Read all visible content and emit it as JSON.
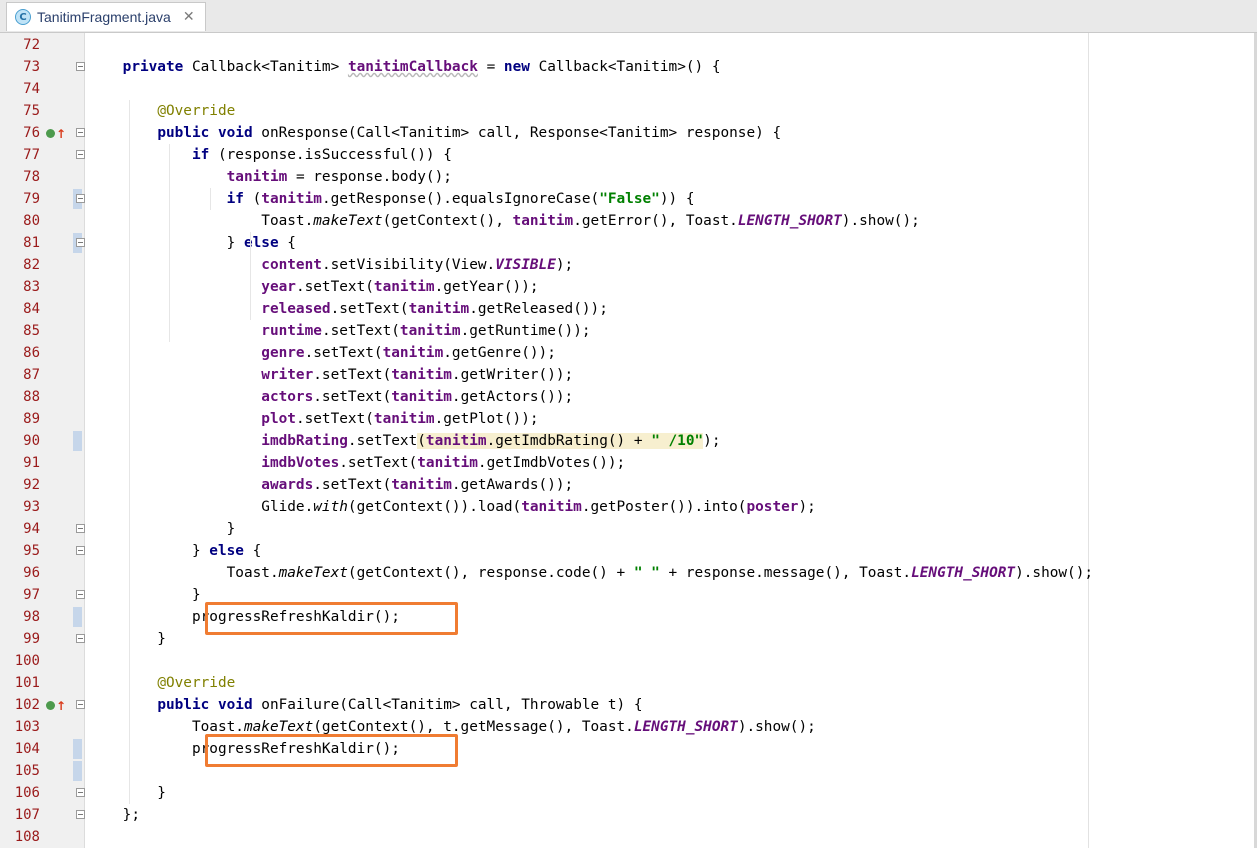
{
  "tab": {
    "icon_letter": "C",
    "file_name": "TanitimFragment.java",
    "close_glyph": "✕"
  },
  "colors": {
    "highlight_box": "#f07c32",
    "keyword": "#000080",
    "field": "#660e7a",
    "string": "#008000",
    "annotation": "#808000",
    "line_number": "#9a1a1a"
  },
  "lines": [
    {
      "num": "72",
      "html": ""
    },
    {
      "num": "73",
      "html": "    <span class=\"kw\">private</span> Callback&lt;Tanitim&gt; <span class=\"fld under\">tanitimCallback</span> = <span class=\"kw\">new</span> Callback&lt;Tanitim&gt;() {"
    },
    {
      "num": "74",
      "html": ""
    },
    {
      "num": "75",
      "html": "        <span class=\"ann\">@Override</span>"
    },
    {
      "num": "76",
      "html": "        <span class=\"kw\">public void</span> onResponse(Call&lt;Tanitim&gt; call, Response&lt;Tanitim&gt; response) {"
    },
    {
      "num": "77",
      "html": "            <span class=\"kw\">if</span> (response.isSuccessful()) {"
    },
    {
      "num": "78",
      "html": "                <span class=\"fld\">tanitim</span> = response.body();"
    },
    {
      "num": "79",
      "html": "                <span class=\"kw\">if</span> (<span class=\"fld\">tanitim</span>.getResponse().equalsIgnoreCase(<span class=\"str\">\"False\"</span>)) {"
    },
    {
      "num": "80",
      "html": "                    Toast.<span class=\"it\">makeText</span>(getContext(), <span class=\"fld\">tanitim</span>.getError(), Toast.<span class=\"st\">LENGTH_SHORT</span>).show();"
    },
    {
      "num": "81",
      "html": "                } <span class=\"kw\">else</span> {"
    },
    {
      "num": "82",
      "html": "                    <span class=\"fld\">content</span>.setVisibility(View.<span class=\"st\">VISIBLE</span>);"
    },
    {
      "num": "83",
      "html": "                    <span class=\"fld\">year</span>.setText(<span class=\"fld\">tanitim</span>.getYear());"
    },
    {
      "num": "84",
      "html": "                    <span class=\"fld\">released</span>.setText(<span class=\"fld\">tanitim</span>.getReleased());"
    },
    {
      "num": "85",
      "html": "                    <span class=\"fld\">runtime</span>.setText(<span class=\"fld\">tanitim</span>.getRuntime());"
    },
    {
      "num": "86",
      "html": "                    <span class=\"fld\">genre</span>.setText(<span class=\"fld\">tanitim</span>.getGenre());"
    },
    {
      "num": "87",
      "html": "                    <span class=\"fld\">writer</span>.setText(<span class=\"fld\">tanitim</span>.getWriter());"
    },
    {
      "num": "88",
      "html": "                    <span class=\"fld\">actors</span>.setText(<span class=\"fld\">tanitim</span>.getActors());"
    },
    {
      "num": "89",
      "html": "                    <span class=\"fld\">plot</span>.setText(<span class=\"fld\">tanitim</span>.getPlot());"
    },
    {
      "num": "90",
      "html": "                    <span class=\"fld\">imdbRating</span>.setText<span class=\"hl\">(<span class=\"fld\">tanitim</span>.getImdbRating() + <span class=\"str\">\" /10\"</span></span>);"
    },
    {
      "num": "91",
      "html": "                    <span class=\"fld\">imdbVotes</span>.setText(<span class=\"fld\">tanitim</span>.getImdbVotes());"
    },
    {
      "num": "92",
      "html": "                    <span class=\"fld\">awards</span>.setText(<span class=\"fld\">tanitim</span>.getAwards());"
    },
    {
      "num": "93",
      "html": "                    Glide.<span class=\"it\">with</span>(getContext()).load(<span class=\"fld\">tanitim</span>.getPoster()).into(<span class=\"fld\">poster</span>);"
    },
    {
      "num": "94",
      "html": "                }"
    },
    {
      "num": "95",
      "html": "            } <span class=\"kw\">else</span> {"
    },
    {
      "num": "96",
      "html": "                Toast.<span class=\"it\">makeText</span>(getContext(), response.code() + <span class=\"str\">\" \"</span> + response.message(), Toast.<span class=\"st\">LENGTH_SHORT</span>).show();"
    },
    {
      "num": "97",
      "html": "            }"
    },
    {
      "num": "98",
      "html": "            progressRefreshKaldir();"
    },
    {
      "num": "99",
      "html": "        }"
    },
    {
      "num": "100",
      "html": ""
    },
    {
      "num": "101",
      "html": "        <span class=\"ann\">@Override</span>"
    },
    {
      "num": "102",
      "html": "        <span class=\"kw\">public void</span> onFailure(Call&lt;Tanitim&gt; call, Throwable t) {"
    },
    {
      "num": "103",
      "html": "            Toast.<span class=\"it\">makeText</span>(getContext(), t.getMessage(), Toast.<span class=\"st\">LENGTH_SHORT</span>).show();"
    },
    {
      "num": "104",
      "html": "            progressRefreshKaldir();"
    },
    {
      "num": "105",
      "html": ""
    },
    {
      "num": "106",
      "html": "        }"
    },
    {
      "num": "107",
      "html": "    };"
    },
    {
      "num": "108",
      "html": ""
    }
  ]
}
